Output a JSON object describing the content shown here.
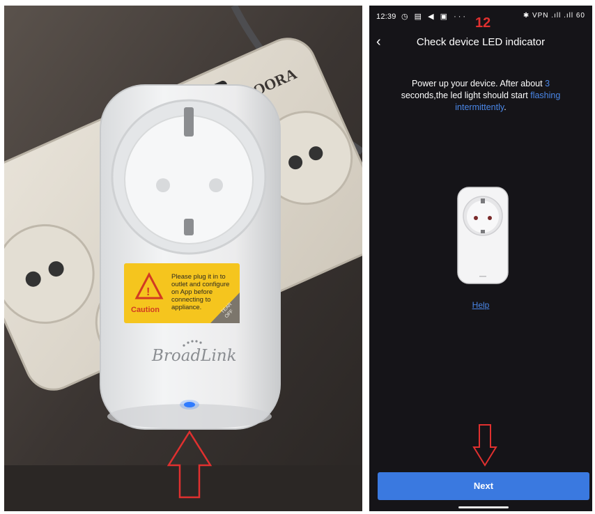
{
  "photo": {
    "power_strip_brand": "MOORA",
    "sticker_lines": [
      "Please plug it in to",
      "outlet and configure",
      "on App before",
      "connecting to",
      "appliance."
    ],
    "sticker_caution": "Caution",
    "sticker_tear_top": "TEAR",
    "sticker_tear_bottom": "OFF",
    "plug_brand": "BroadLink"
  },
  "phone": {
    "status_time": "12:39",
    "status_left_icons": "◷ ▤ ◀ ▣ ···",
    "status_right_icons": "✱ VPN .ıll .ıll 60",
    "step_number": "12",
    "back_glyph": "‹",
    "title": "Check device LED indicator",
    "instruction": {
      "part1": "Power up your device. After about ",
      "highlight1": "3",
      "part2": " seconds,the led light should start ",
      "highlight2": "flashing intermittently",
      "part3": "."
    },
    "help_link": "Help",
    "next_button": "Next"
  },
  "colors": {
    "accent_blue": "#3a79e0",
    "highlight_blue": "#4a87e8",
    "annotation_red": "#e0302f",
    "phone_bg": "#151418"
  }
}
